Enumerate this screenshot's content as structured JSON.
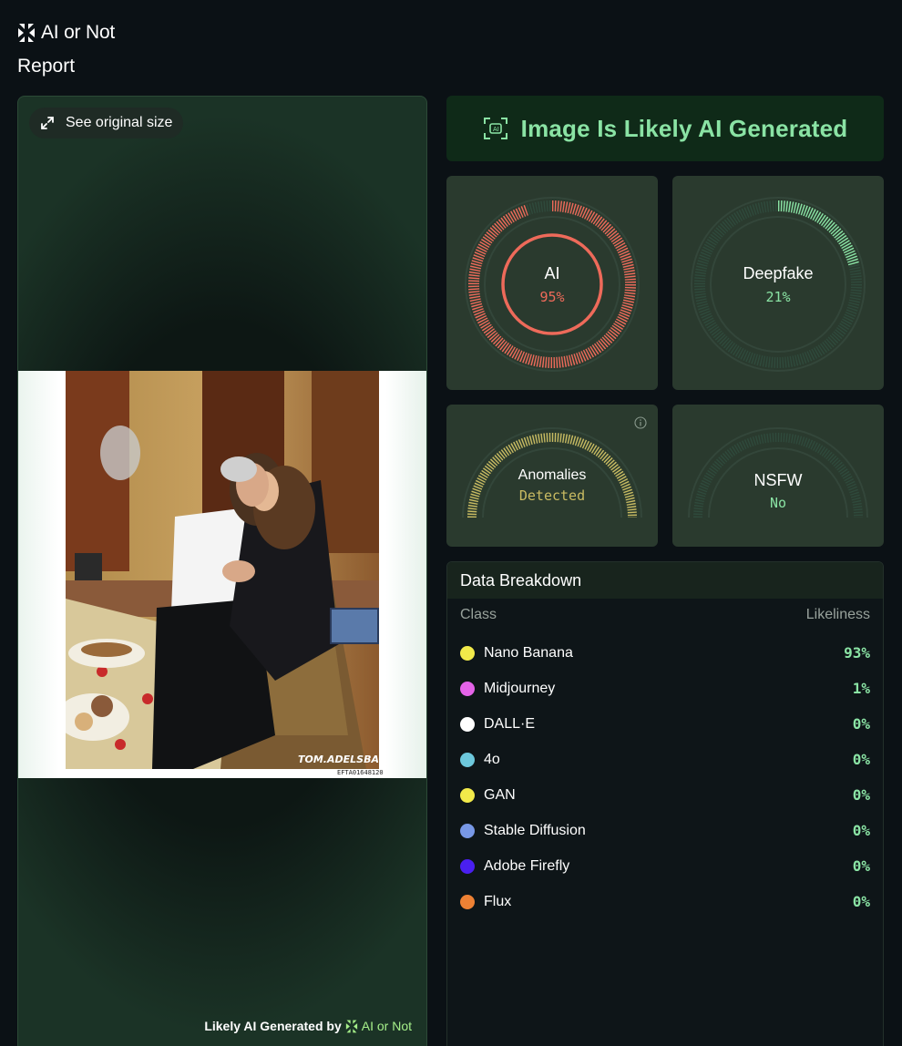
{
  "app": {
    "brand_name": "AI or Not",
    "page_title": "Report"
  },
  "image_panel": {
    "see_original_label": "See original size",
    "photo_caption": "EFTA01648120",
    "photo_watermark": "TOM.ADELSBACH",
    "footer_prefix": "Likely AI Generated by",
    "footer_brand": "AI or Not"
  },
  "verdict": {
    "text": "Image Is Likely AI Generated",
    "icon": "scan-icon"
  },
  "scores": {
    "ai": {
      "label": "AI",
      "value": "95%",
      "fraction": 0.95,
      "color": "#ee6a5a"
    },
    "deepfake": {
      "label": "Deepfake",
      "value": "21%",
      "fraction": 0.21,
      "color": "#8ae3a4"
    },
    "anomalies": {
      "label": "Anomalies",
      "value": "Detected",
      "color": "#c9bb62"
    },
    "nsfw": {
      "label": "NSFW",
      "value": "No",
      "color": "#8ae3a4"
    }
  },
  "breakdown": {
    "title": "Data Breakdown",
    "col_class": "Class",
    "col_likeliness": "Likeliness",
    "rows": [
      {
        "name": "Nano Banana",
        "value": "93%",
        "color": "#f2ea4a"
      },
      {
        "name": "Midjourney",
        "value": "1%",
        "color": "#e463e8"
      },
      {
        "name": "DALL·E",
        "value": "0%",
        "color": "#ffffff"
      },
      {
        "name": "4o",
        "value": "0%",
        "color": "#6dc8dc"
      },
      {
        "name": "GAN",
        "value": "0%",
        "color": "#f2ea4a"
      },
      {
        "name": "Stable Diffusion",
        "value": "0%",
        "color": "#7898e6"
      },
      {
        "name": "Adobe Firefly",
        "value": "0%",
        "color": "#4a1ff0"
      },
      {
        "name": "Flux",
        "value": "0%",
        "color": "#ee8134"
      }
    ]
  }
}
